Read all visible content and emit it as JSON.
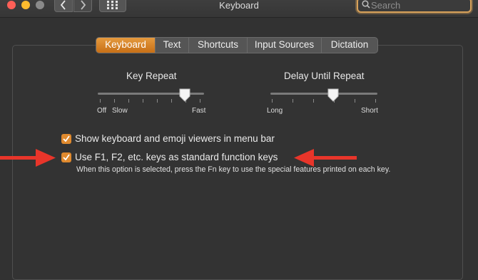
{
  "window": {
    "title": "Keyboard"
  },
  "toolbar": {
    "search_placeholder": "Search",
    "back_icon": "chevron-left-icon",
    "forward_icon": "chevron-right-icon",
    "grid_icon": "grid-icon"
  },
  "tabs": [
    {
      "label": "Keyboard",
      "active": true
    },
    {
      "label": "Text",
      "active": false
    },
    {
      "label": "Shortcuts",
      "active": false
    },
    {
      "label": "Input Sources",
      "active": false
    },
    {
      "label": "Dictation",
      "active": false
    }
  ],
  "sliders": {
    "key_repeat": {
      "title": "Key Repeat",
      "labels": [
        "Off",
        "Slow",
        "Fast"
      ],
      "value_fraction": 0.83
    },
    "delay_until_repeat": {
      "title": "Delay Until Repeat",
      "labels": [
        "Long",
        "Short"
      ],
      "value_fraction": 0.6
    }
  },
  "options": {
    "viewers_label": "Show keyboard and emoji viewers in menu bar",
    "viewers_checked": true,
    "fn_keys_label": "Use F1, F2, etc. keys as standard function keys",
    "fn_keys_checked": true,
    "fn_keys_help": "When this option is selected, press the Fn key to use the special features printed on each key."
  },
  "colors": {
    "accent": "#e08a2e",
    "annotation_arrow": "#e8352a"
  }
}
